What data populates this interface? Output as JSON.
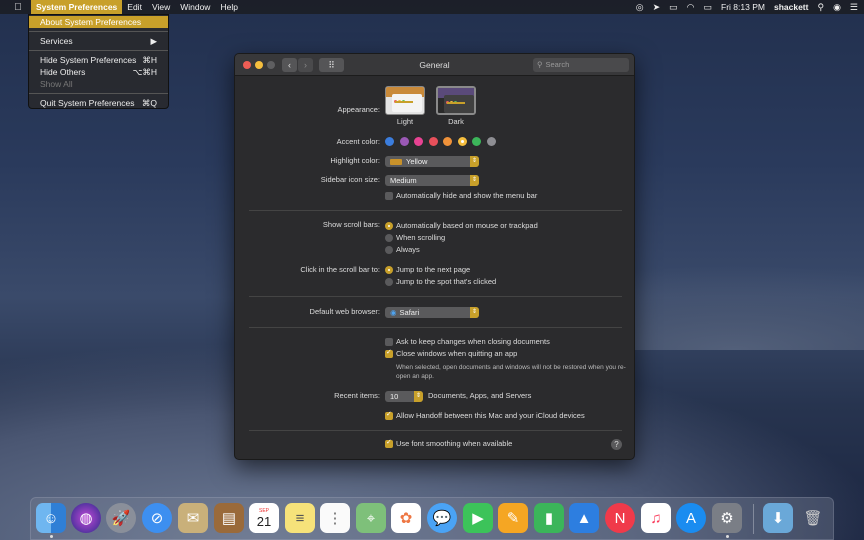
{
  "menubar": {
    "app_menu": "System Preferences",
    "menus": [
      "Edit",
      "View",
      "Window",
      "Help"
    ],
    "clock": "Fri 8:13 PM",
    "user": "shackett"
  },
  "app_dropdown": {
    "items": [
      {
        "label": "About System Preferences",
        "shortcut": ""
      },
      {
        "label": "Services",
        "shortcut": "▶"
      },
      {
        "label": "Hide System Preferences",
        "shortcut": "⌘H"
      },
      {
        "label": "Hide Others",
        "shortcut": "⌥⌘H"
      },
      {
        "label": "Show All",
        "shortcut": ""
      },
      {
        "label": "Quit System Preferences",
        "shortcut": "⌘Q"
      }
    ]
  },
  "window": {
    "title": "General",
    "search_placeholder": "Search"
  },
  "appearance": {
    "label": "Appearance:",
    "options": [
      "Light",
      "Dark"
    ],
    "selected": "Dark"
  },
  "accent": {
    "label": "Accent color:",
    "colors": [
      "#3b7ddd",
      "#9b59b6",
      "#e84393",
      "#e8505b",
      "#f0923a",
      "#f5be3e",
      "#3cb55a",
      "#8e8e93"
    ],
    "selected_index": 5
  },
  "highlight": {
    "label": "Highlight color:",
    "value": "Yellow"
  },
  "sidebar_icon": {
    "label": "Sidebar icon size:",
    "value": "Medium"
  },
  "menubar_hide": {
    "label": "Automatically hide and show the menu bar",
    "checked": false
  },
  "scroll_bars": {
    "label": "Show scroll bars:",
    "options": [
      "Automatically based on mouse or trackpad",
      "When scrolling",
      "Always"
    ],
    "selected_index": 0
  },
  "scroll_click": {
    "label": "Click in the scroll bar to:",
    "options": [
      "Jump to the next page",
      "Jump to the spot that's clicked"
    ],
    "selected_index": 0
  },
  "browser": {
    "label": "Default web browser:",
    "value": "Safari"
  },
  "documents": {
    "ask_keep": {
      "label": "Ask to keep changes when closing documents",
      "checked": false
    },
    "close_windows": {
      "label": "Close windows when quitting an app",
      "checked": true
    },
    "note": "When selected, open documents and windows will not be restored when you re-open an app."
  },
  "recent": {
    "label": "Recent items:",
    "value": "10",
    "suffix": "Documents, Apps, and Servers"
  },
  "handoff": {
    "label": "Allow Handoff between this Mac and your iCloud devices",
    "checked": true
  },
  "font_smoothing": {
    "label": "Use font smoothing when available",
    "checked": true
  },
  "help": "?",
  "dock": {
    "calendar_month": "SEP",
    "calendar_day": "21",
    "icons": [
      "finder-icon",
      "siri-icon",
      "launchpad-icon",
      "safari-icon",
      "mail-stamp-icon",
      "notes-book-icon",
      "calendar-icon",
      "notes-icon",
      "reminders-icon",
      "maps-icon",
      "photos-icon",
      "messages-icon",
      "facetime-icon",
      "pages-icon",
      "numbers-icon",
      "keynote-icon",
      "news-icon",
      "music-icon",
      "app-store-icon",
      "system-preferences-icon",
      "downloads-folder-icon",
      "trash-icon"
    ]
  }
}
